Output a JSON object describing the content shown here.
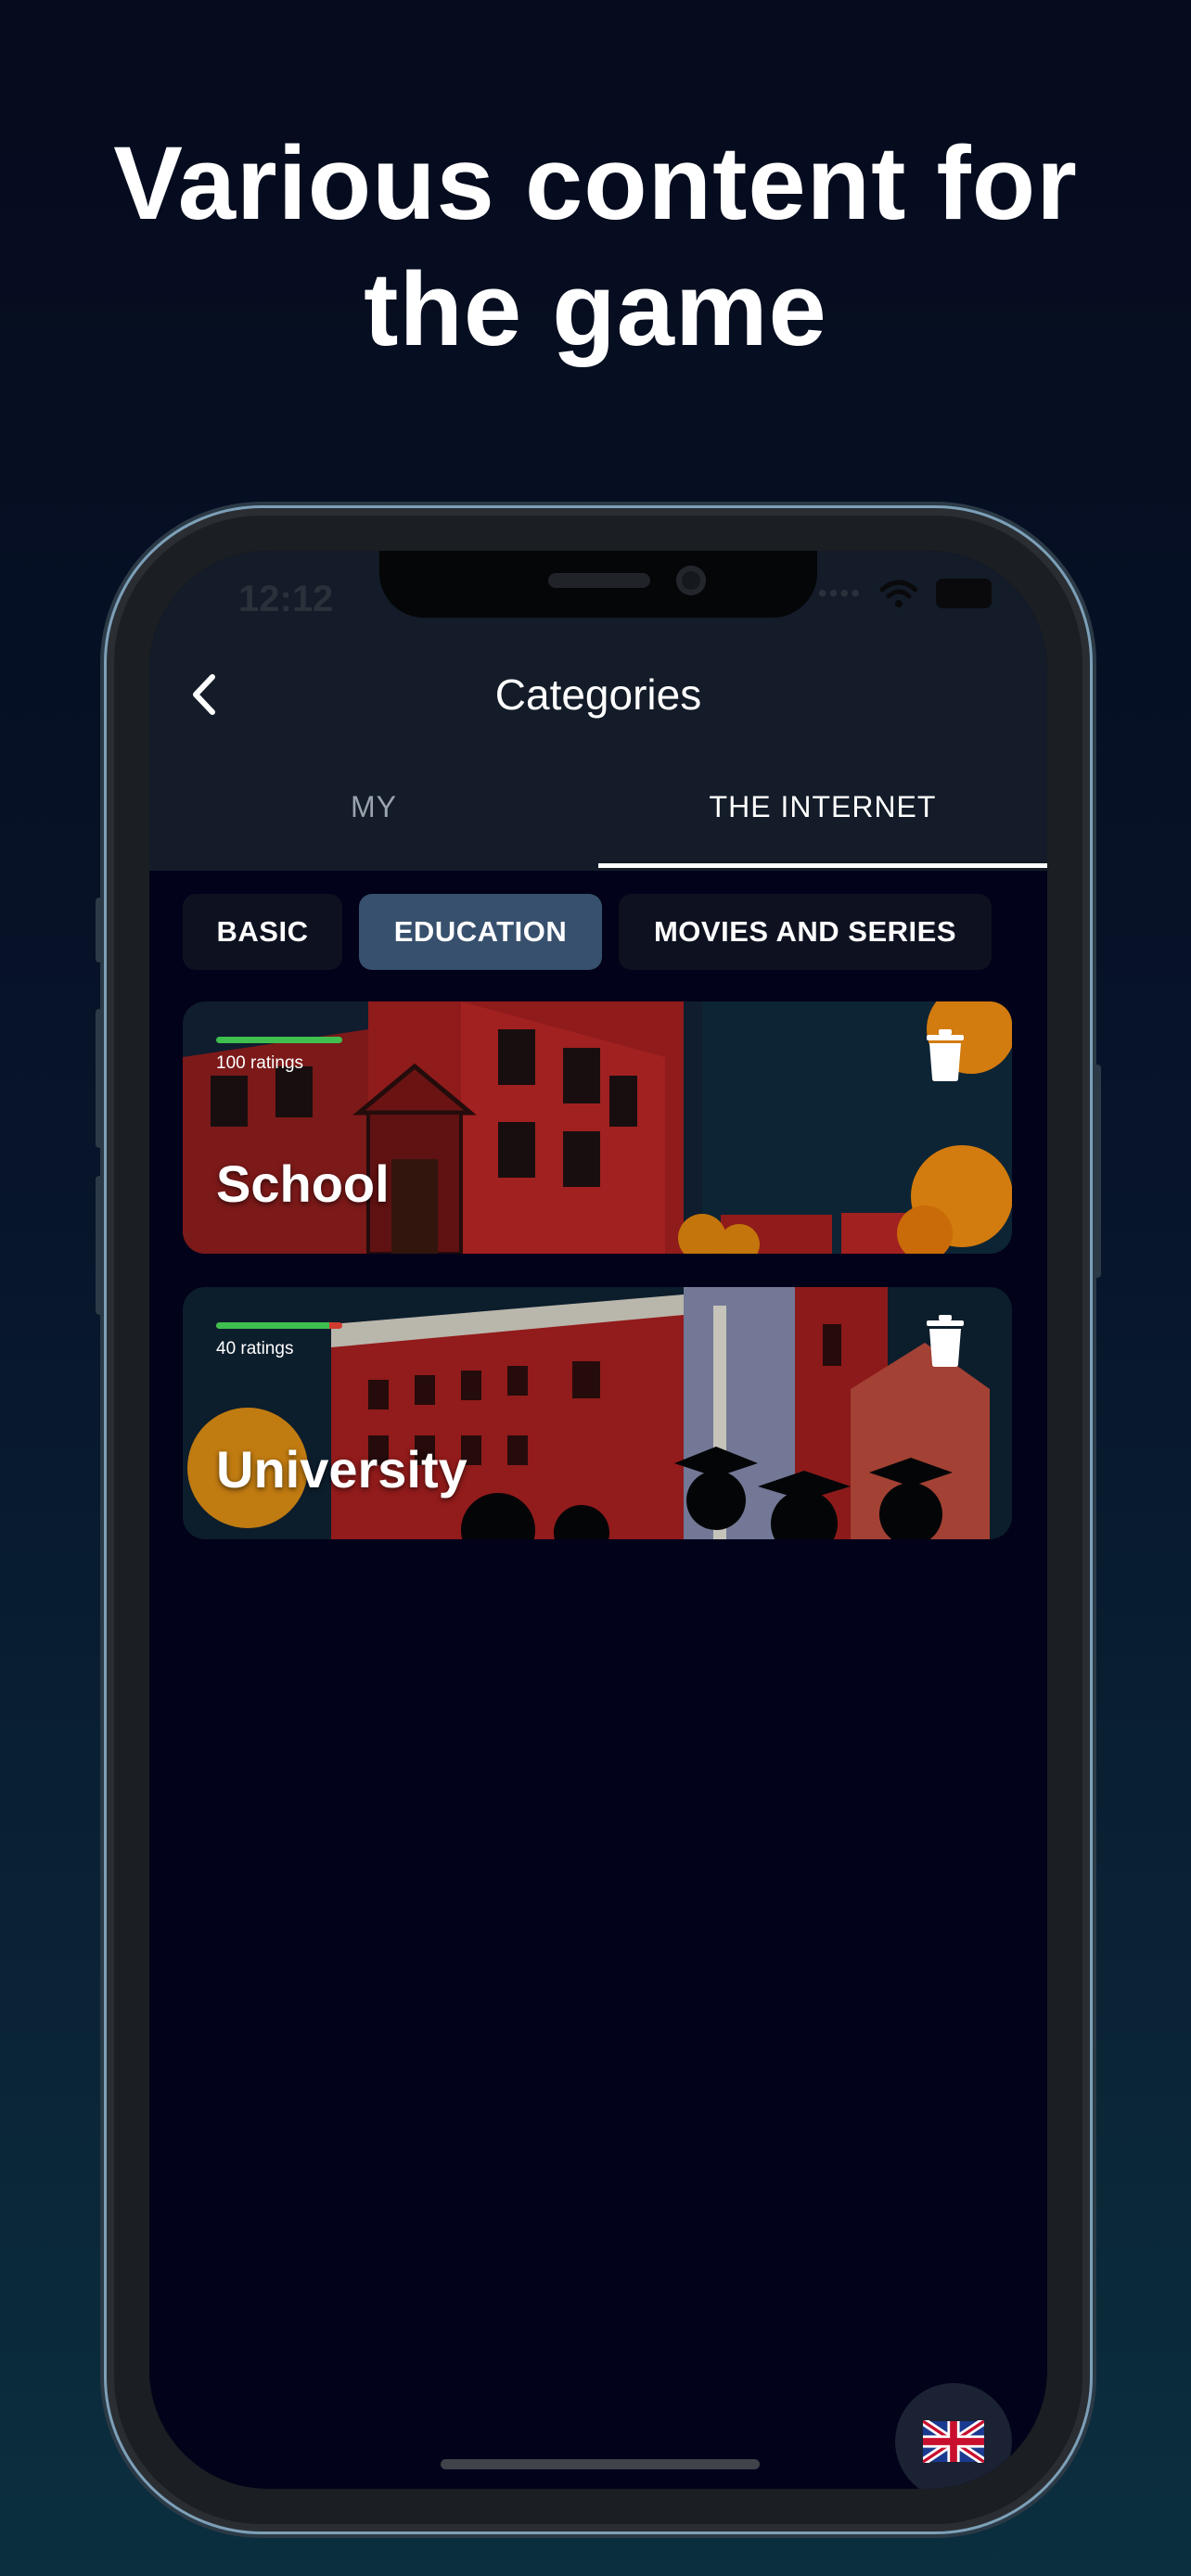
{
  "headline": {
    "line1": "Various content for",
    "line2": "the game"
  },
  "status_bar": {
    "time": "12:12"
  },
  "nav": {
    "title": "Categories"
  },
  "tabs": [
    {
      "label": "MY",
      "active": false
    },
    {
      "label": "THE INTERNET",
      "active": true
    }
  ],
  "chips": [
    {
      "label": "BASIC",
      "selected": false
    },
    {
      "label": "EDUCATION",
      "selected": true
    },
    {
      "label": "MOVIES AND SERIES",
      "selected": false
    }
  ],
  "cards": [
    {
      "title": "School",
      "ratings": "100 ratings",
      "positive_fraction": 1.0
    },
    {
      "title": "University",
      "ratings": "40 ratings",
      "positive_fraction": 0.9
    }
  ],
  "colors": {
    "background_top": "#060b1d",
    "background_bottom": "#0b2f3f",
    "selected_chip": "#37506d",
    "rating_positive": "#3fbf4f",
    "rating_negative": "#d23b2f"
  },
  "icons": {
    "back": "chevron-left-icon",
    "delete": "trash-icon",
    "language": "uk-flag-icon",
    "wifi": "wifi-icon",
    "battery": "battery-icon"
  }
}
